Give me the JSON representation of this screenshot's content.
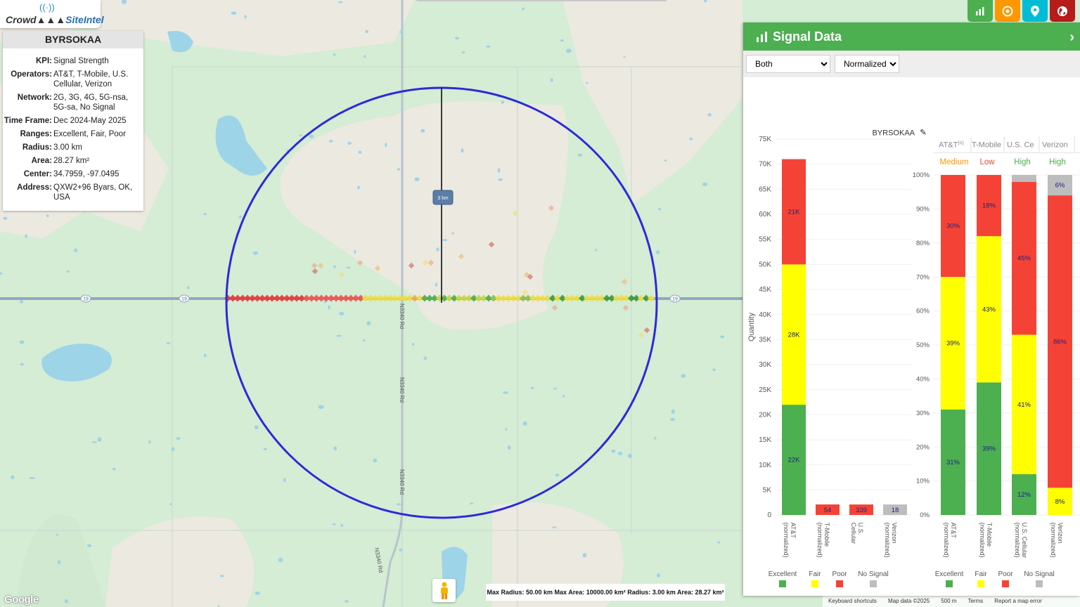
{
  "app": {
    "logo_text_1": "Crowd",
    "logo_text_2": "SiteIntel"
  },
  "info": {
    "title": "BYRSOKAA",
    "rows": [
      {
        "k": "KPI:",
        "v": "Signal Strength"
      },
      {
        "k": "Operators:",
        "v": "AT&T, T-Mobile, U.S. Cellular, Verizon"
      },
      {
        "k": "Network:",
        "v": "2G, 3G, 4G, 5G-nsa, 5G-sa, No Signal"
      },
      {
        "k": "Time Frame:",
        "v": "Dec 2024-May 2025"
      },
      {
        "k": "Ranges:",
        "v": "Excellent, Fair, Poor"
      },
      {
        "k": "Radius:",
        "v": "3.00 km"
      },
      {
        "k": "Area:",
        "v": "28.27 km²"
      },
      {
        "k": "Center:",
        "v": "34.7959, -97.0495"
      },
      {
        "k": "Address:",
        "v": "QXW2+96 Byars, OK, USA"
      }
    ]
  },
  "top_buttons": [
    {
      "name": "chart-button",
      "color": "#4caf50",
      "icon": "bar-chart-icon"
    },
    {
      "name": "target-button",
      "color": "#ff9800",
      "icon": "target-icon"
    },
    {
      "name": "location-button",
      "color": "#00bcd4",
      "icon": "map-pin-icon"
    },
    {
      "name": "globe-button",
      "color": "#b71c1c",
      "icon": "globe-icon"
    }
  ],
  "map": {
    "scale_label": "3 km",
    "road_labels": [
      "N3340 Rd",
      "N3340 Rd",
      "N3340 Rd",
      "N3340 Rd"
    ],
    "highway_shield": "19"
  },
  "bottom": {
    "max_box": "Max Radius: 50.00 km  Max Area: 10000.00 km²  Radius: 3.00 km  Area: 28.27 km²",
    "google": "Google",
    "attrib": [
      "Keyboard shortcuts",
      "Map data ©2025",
      "500 m",
      "Terms",
      "Report a map error"
    ]
  },
  "panel": {
    "title": "Signal Data",
    "select_mode": "Both",
    "select_scale": "Normalized",
    "chart_title": "BYRSOKAA"
  },
  "colors": {
    "excellent": "#4caf50",
    "fair": "#ffff00",
    "poor": "#f44336",
    "nosignal": "#bdbdbd",
    "circle": "#2b2bd6"
  },
  "chart_data": [
    {
      "type": "bar",
      "stacked": true,
      "title": "BYRSOKAA",
      "ylabel": "Quantity",
      "ylim": [
        0,
        75000
      ],
      "y_ticks": [
        "0",
        "5K",
        "10K",
        "15K",
        "20K",
        "25K",
        "30K",
        "35K",
        "40K",
        "45K",
        "50K",
        "55K",
        "60K",
        "65K",
        "70K",
        "75K"
      ],
      "categories": [
        "AT&T (normalized)",
        "T-Mobile (normalized)",
        "U.S. Cellular (normalized)",
        "Verizon (normalized)"
      ],
      "series": [
        {
          "name": "Excellent",
          "values": [
            22000,
            0,
            0,
            0
          ],
          "labels": [
            "22K",
            "",
            "",
            ""
          ]
        },
        {
          "name": "Fair",
          "values": [
            28000,
            10,
            0,
            0
          ],
          "labels": [
            "28K",
            "",
            "",
            ""
          ]
        },
        {
          "name": "Poor",
          "values": [
            21000,
            44,
            339,
            0
          ],
          "labels": [
            "21K",
            "54",
            "339",
            ""
          ]
        },
        {
          "name": "No Signal",
          "values": [
            0,
            0,
            0,
            18
          ],
          "labels": [
            "",
            "",
            "",
            "18"
          ]
        }
      ],
      "legend": [
        "Excellent",
        "Fair",
        "Poor",
        "No Signal"
      ]
    },
    {
      "type": "bar",
      "stacked": true,
      "ylim": [
        0,
        100
      ],
      "y_ticks": [
        "0%",
        "10%",
        "20%",
        "30%",
        "40%",
        "50%",
        "60%",
        "70%",
        "80%",
        "90%",
        "100%"
      ],
      "categories": [
        "AT&T (normalized)",
        "T-Mobile (normalized)",
        "U.S. Cellular (normalized)",
        "Verizon (normalized)"
      ],
      "headers": [
        "AT&T",
        "T-Mobile",
        "U.S. Ce",
        "Verizon"
      ],
      "header_sup": [
        "(n)",
        "",
        "",
        ""
      ],
      "ratings": [
        "Medium",
        "Low",
        "High",
        "High"
      ],
      "rating_colors": [
        "#ff9800",
        "#f44336",
        "#4caf50",
        "#4caf50"
      ],
      "series": [
        {
          "name": "Excellent",
          "values": [
            31,
            39,
            12,
            0
          ],
          "labels": [
            "31%",
            "39%",
            "12%",
            ""
          ]
        },
        {
          "name": "Fair",
          "values": [
            39,
            43,
            41,
            8
          ],
          "labels": [
            "39%",
            "43%",
            "41%",
            "8%"
          ]
        },
        {
          "name": "Poor",
          "values": [
            30,
            18,
            45,
            86
          ],
          "labels": [
            "30%",
            "18%",
            "45%",
            "86%"
          ]
        },
        {
          "name": "No Signal",
          "values": [
            0,
            0,
            2,
            6
          ],
          "labels": [
            "",
            "",
            "",
            "6%"
          ]
        }
      ],
      "legend": [
        "Excellent",
        "Fair",
        "Poor",
        "No Signal"
      ]
    }
  ]
}
